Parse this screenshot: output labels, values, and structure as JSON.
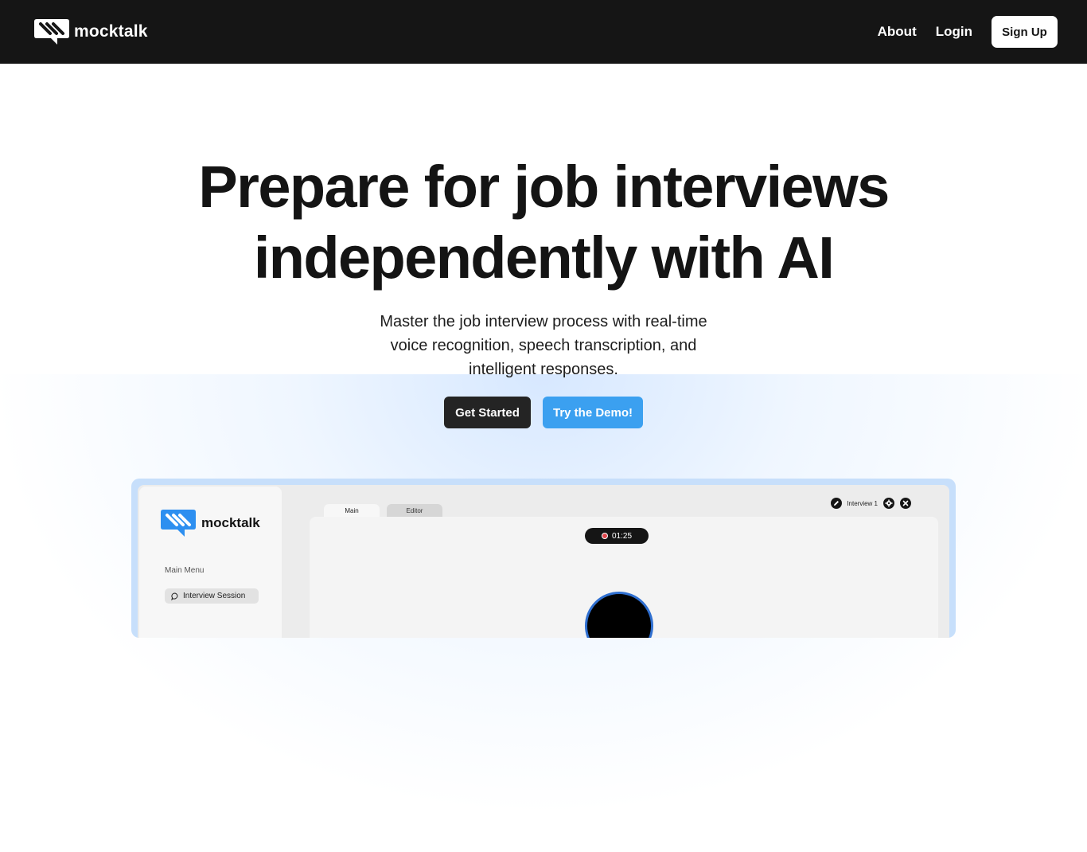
{
  "navbar": {
    "brand": "mocktalk",
    "links": {
      "about": "About",
      "login": "Login"
    },
    "signup_label": "Sign Up"
  },
  "hero": {
    "title_line1": "Prepare for job interviews",
    "title_line2": "independently with AI",
    "subtitle": "Master the job interview process with real-time voice recognition, speech transcription, and intelligent responses.",
    "cta_primary": "Get Started",
    "cta_demo": "Try the Demo!"
  },
  "preview": {
    "brand": "mocktalk",
    "menu_label": "Main Menu",
    "menu_item": "Interview Session",
    "tabs": [
      "Main",
      "Editor"
    ],
    "session_name": "Interview 1",
    "timer": "01:25"
  },
  "colors": {
    "navbar_bg": "#151515",
    "accent_blue": "#3ba0f0",
    "cta_dark": "#242424",
    "recording_red": "#e0474c"
  },
  "icons": [
    "mocktalk-logo-icon",
    "chat-bubble-icon",
    "pencil-icon",
    "gear-icon",
    "close-icon",
    "record-icon"
  ]
}
